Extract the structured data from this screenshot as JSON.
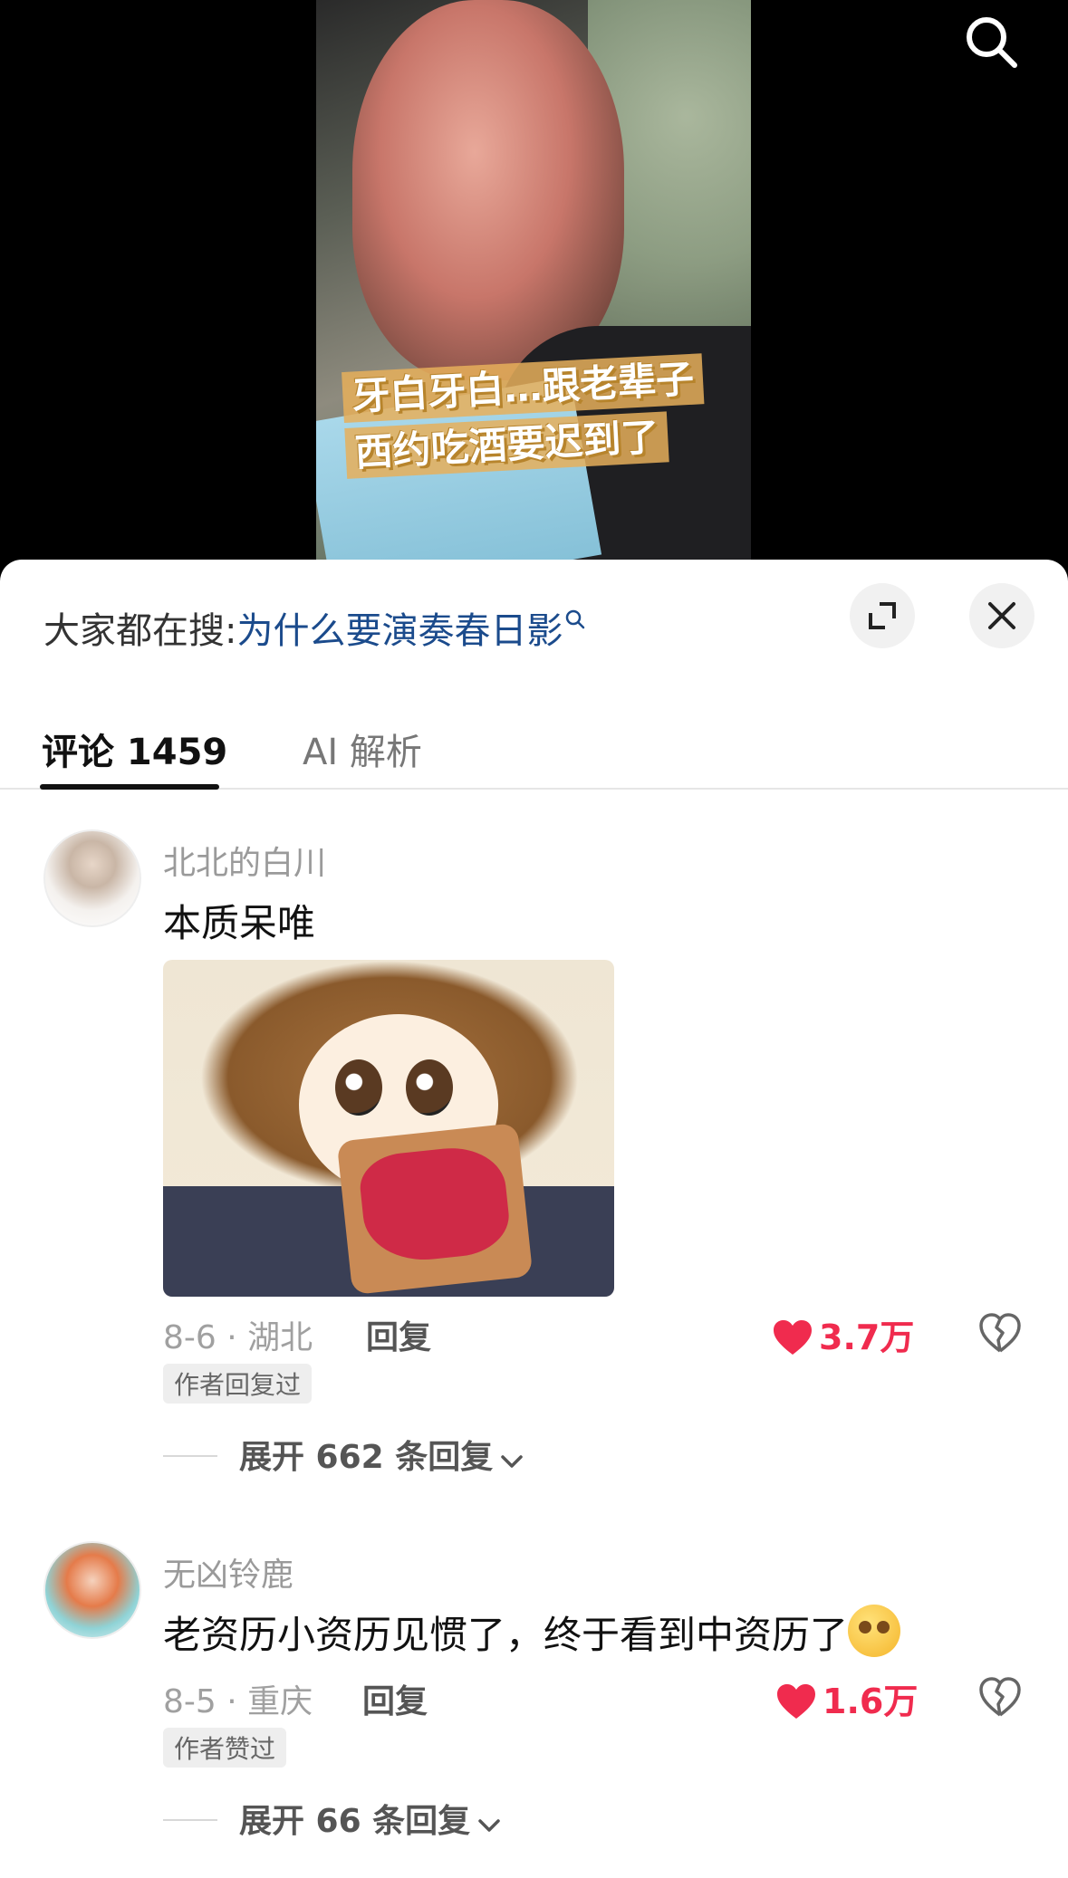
{
  "video": {
    "caption_line1": "牙白牙白…跟老辈子",
    "caption_line2": "西约吃酒要迟到了"
  },
  "sheet": {
    "hot_search_prefix": "大家都在搜:",
    "hot_search_query": "为什么要演奏春日影",
    "tabs": [
      {
        "label": "评论 1459",
        "active": true
      },
      {
        "label": "AI 解析",
        "active": false
      }
    ]
  },
  "comments": [
    {
      "username": "北北的白川",
      "text": "本质呆唯",
      "date_location": "8-6 · 湖北",
      "reply_label": "回复",
      "likes": "3.7万",
      "badge": "作者回复过",
      "expand_label": "展开 662 条回复"
    },
    {
      "username": "无凶铃鹿",
      "text": "老资历小资历见惯了，终于看到中资历了",
      "date_location": "8-5 · 重庆",
      "reply_label": "回复",
      "likes": "1.6万",
      "badge": "作者赞过",
      "expand_label": "展开 66 条回复"
    }
  ],
  "colors": {
    "like_red": "#f02b4e",
    "query_blue": "#1b4b8c"
  }
}
